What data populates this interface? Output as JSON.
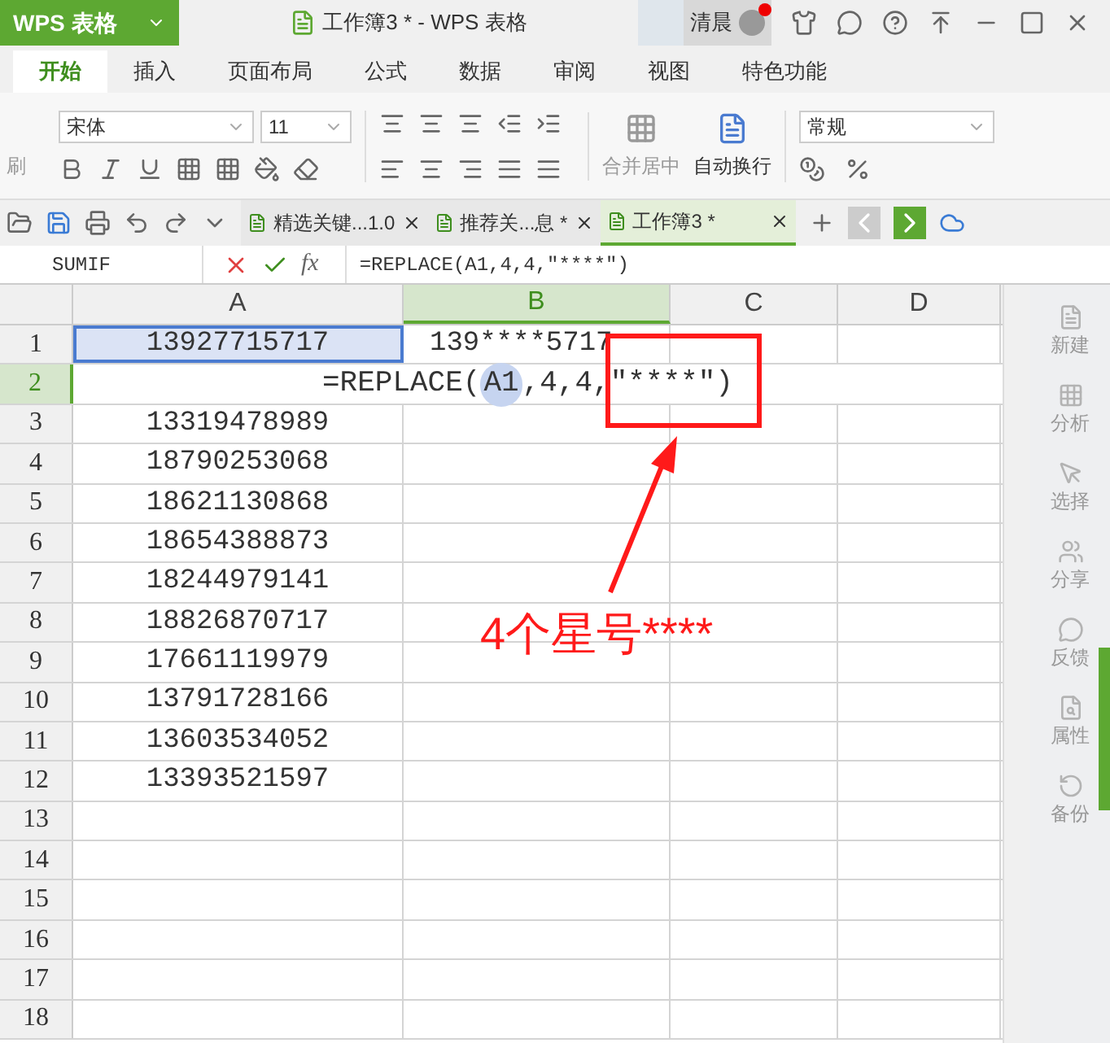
{
  "title_bar": {
    "app_button": "WPS 表格",
    "title": "工作簿3 * - WPS 表格",
    "user": "清晨",
    "has_notification": true
  },
  "menu_tabs": [
    {
      "label": "开始",
      "selected": true
    },
    {
      "label": "插入",
      "selected": false
    },
    {
      "label": "页面布局",
      "selected": false
    },
    {
      "label": "公式",
      "selected": false
    },
    {
      "label": "数据",
      "selected": false
    },
    {
      "label": "审阅",
      "selected": false
    },
    {
      "label": "视图",
      "selected": false
    },
    {
      "label": "特色功能",
      "selected": false
    }
  ],
  "ribbon": {
    "format_painter": "刷",
    "font": "宋体",
    "font_size": "11",
    "merge": "合并居中",
    "wrap": "自动换行",
    "number_format": "常规"
  },
  "doc_tabs": [
    {
      "label": "精选关键...1.0",
      "selected": false
    },
    {
      "label": "推荐关...息 *",
      "selected": false
    },
    {
      "label": "工作簿3 *",
      "selected": true
    }
  ],
  "formula_bar": {
    "name_box": "SUMIF",
    "fx": "fx",
    "formula": "=REPLACE(A1,4,4,″****″)"
  },
  "sheet": {
    "columns": [
      {
        "label": "A",
        "selected": false
      },
      {
        "label": "B",
        "selected": true
      },
      {
        "label": "C",
        "selected": false
      },
      {
        "label": "D",
        "selected": false
      }
    ],
    "editing": {
      "before": "=REPLACE(",
      "ref": "A1",
      "after": ",4,4,″****″)"
    },
    "rows": [
      {
        "number": "1",
        "selected": false,
        "cells": [
          {
            "text": "13927715717",
            "selected": true
          },
          {
            "text": "139****5717",
            "selected": false
          }
        ]
      },
      {
        "number": "2",
        "selected": true,
        "kind": "editing",
        "cells": []
      },
      {
        "number": "3",
        "selected": false,
        "cells": [
          {
            "text": "13319478989",
            "selected": false
          }
        ]
      },
      {
        "number": "4",
        "selected": false,
        "cells": [
          {
            "text": "18790253068",
            "selected": false
          }
        ]
      },
      {
        "number": "5",
        "selected": false,
        "cells": [
          {
            "text": "18621130868",
            "selected": false
          }
        ]
      },
      {
        "number": "6",
        "selected": false,
        "cells": [
          {
            "text": "18654388873",
            "selected": false
          }
        ]
      },
      {
        "number": "7",
        "selected": false,
        "cells": [
          {
            "text": "18244979141",
            "selected": false
          }
        ]
      },
      {
        "number": "8",
        "selected": false,
        "cells": [
          {
            "text": "18826870717",
            "selected": false
          }
        ]
      },
      {
        "number": "9",
        "selected": false,
        "cells": [
          {
            "text": "17661119979",
            "selected": false
          }
        ]
      },
      {
        "number": "10",
        "selected": false,
        "cells": [
          {
            "text": "13791728166",
            "selected": false
          }
        ]
      },
      {
        "number": "11",
        "selected": false,
        "cells": [
          {
            "text": "13603534052",
            "selected": false
          }
        ]
      },
      {
        "number": "12",
        "selected": false,
        "cells": [
          {
            "text": "13393521597",
            "selected": false
          }
        ]
      },
      {
        "number": "13",
        "selected": false,
        "cells": []
      },
      {
        "number": "14",
        "selected": false,
        "cells": []
      },
      {
        "number": "15",
        "selected": false,
        "cells": []
      },
      {
        "number": "16",
        "selected": false,
        "cells": []
      },
      {
        "number": "17",
        "selected": false,
        "cells": []
      },
      {
        "number": "18",
        "selected": false,
        "cells": []
      }
    ]
  },
  "annotation": {
    "text": "4个星号****"
  },
  "side_panel": [
    {
      "label": "新建",
      "kind": "new"
    },
    {
      "label": "分析",
      "kind": "analyze"
    },
    {
      "label": "选择",
      "kind": "select"
    },
    {
      "label": "分享",
      "kind": "share"
    },
    {
      "label": "反馈",
      "kind": "feedback"
    },
    {
      "label": "属性",
      "kind": "properties"
    },
    {
      "label": "备份",
      "kind": "backup"
    }
  ]
}
